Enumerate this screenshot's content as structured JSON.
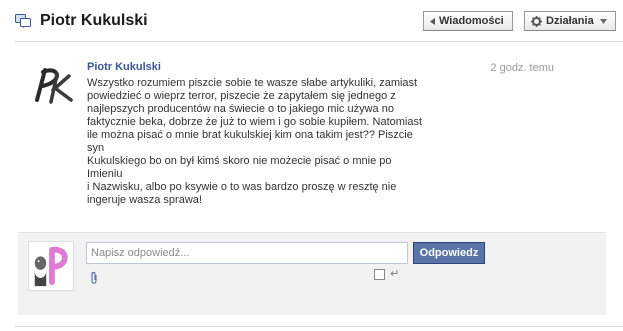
{
  "header": {
    "title": "Piotr Kukulski",
    "messages_button_label": "Wiadomości",
    "actions_button_label": "Działania"
  },
  "thread": {
    "author": "Piotr Kukulski",
    "time": "2 godz. temu",
    "message": "Wszystko rozumiem piszcie sobie te wasze słabe artykuliki, zamiast\npowiedzieć o wieprz terror, piszecie że zapytałem się jednego z\nnajlepszych producentów na świecie o to jakiego mic używa no\nfaktycznie beka, dobrze że już to wiem i go sobie kupiłem. Natomiast\nile można pisać o mnie brat kukulskiej kim ona takim jest?? Piszcie syn\nKukulskiego bo on był kimś skoro nie możecie pisać o mnie po Imieniu\ni Nazwisku, albo po ksywie o to was bardzo proszę w resztę nie\ningeruje wasza sprawa!"
  },
  "reply": {
    "placeholder": "Napisz odpowiedź...",
    "submit_label": "Odpowiedz"
  },
  "colors": {
    "link_blue": "#3b5998",
    "button_blue": "#5b74a8",
    "reply_box_bg": "#f2f2f2"
  },
  "icons": {
    "header": "messages-icon",
    "back": "triangle-left-icon",
    "actions": "gear-icon",
    "dropdown": "triangle-down-icon",
    "attach": "paperclip-icon",
    "enter": "enter-key-icon"
  }
}
